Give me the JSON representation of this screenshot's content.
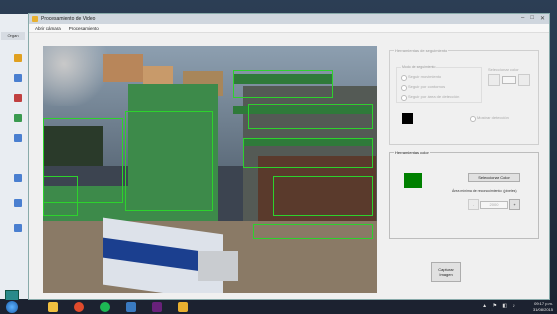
{
  "window": {
    "title": "Procesamiento de Video",
    "controls": [
      "–",
      "□",
      "✕"
    ]
  },
  "menu": [
    {
      "label": "Abrir cámara"
    },
    {
      "label": "Procesamiento"
    }
  ],
  "host_app": {
    "tab_label": "Organ"
  },
  "panel_top": {
    "title": "Herramientas de seguimiento",
    "group_label": "Modo de seguimiento",
    "options": [
      "Seguir movimiento",
      "Seguir por contornos",
      "Seguir por área de detección"
    ],
    "color_button_label": "Seleccionar color",
    "checkbox_label": "Mostrar detección"
  },
  "panel_color": {
    "title": "Herramientas color",
    "select_color_label": "Seleccionar Color",
    "min_area_label": "Área mínima de reconocimiento: (pixeles)",
    "min_area_value": "2000",
    "decrement_label": "-",
    "increment_label": "+",
    "selected_color": "#008000"
  },
  "capture_button": {
    "label_line1": "Capturar",
    "label_line2": "Imagen"
  },
  "taskbar": {
    "time": "09:17 p.m.",
    "date": "31/08/2015"
  }
}
